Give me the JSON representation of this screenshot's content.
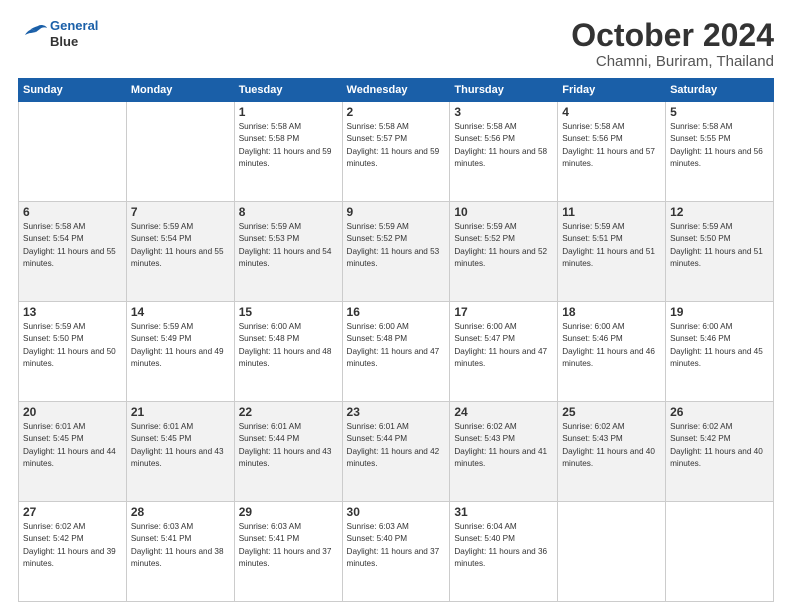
{
  "header": {
    "logo_line1": "General",
    "logo_line2": "Blue",
    "month": "October 2024",
    "location": "Chamni, Buriram, Thailand"
  },
  "weekdays": [
    "Sunday",
    "Monday",
    "Tuesday",
    "Wednesday",
    "Thursday",
    "Friday",
    "Saturday"
  ],
  "weeks": [
    [
      {
        "day": "",
        "info": ""
      },
      {
        "day": "",
        "info": ""
      },
      {
        "day": "1",
        "info": "Sunrise: 5:58 AM\nSunset: 5:58 PM\nDaylight: 11 hours and 59 minutes."
      },
      {
        "day": "2",
        "info": "Sunrise: 5:58 AM\nSunset: 5:57 PM\nDaylight: 11 hours and 59 minutes."
      },
      {
        "day": "3",
        "info": "Sunrise: 5:58 AM\nSunset: 5:56 PM\nDaylight: 11 hours and 58 minutes."
      },
      {
        "day": "4",
        "info": "Sunrise: 5:58 AM\nSunset: 5:56 PM\nDaylight: 11 hours and 57 minutes."
      },
      {
        "day": "5",
        "info": "Sunrise: 5:58 AM\nSunset: 5:55 PM\nDaylight: 11 hours and 56 minutes."
      }
    ],
    [
      {
        "day": "6",
        "info": "Sunrise: 5:58 AM\nSunset: 5:54 PM\nDaylight: 11 hours and 55 minutes."
      },
      {
        "day": "7",
        "info": "Sunrise: 5:59 AM\nSunset: 5:54 PM\nDaylight: 11 hours and 55 minutes."
      },
      {
        "day": "8",
        "info": "Sunrise: 5:59 AM\nSunset: 5:53 PM\nDaylight: 11 hours and 54 minutes."
      },
      {
        "day": "9",
        "info": "Sunrise: 5:59 AM\nSunset: 5:52 PM\nDaylight: 11 hours and 53 minutes."
      },
      {
        "day": "10",
        "info": "Sunrise: 5:59 AM\nSunset: 5:52 PM\nDaylight: 11 hours and 52 minutes."
      },
      {
        "day": "11",
        "info": "Sunrise: 5:59 AM\nSunset: 5:51 PM\nDaylight: 11 hours and 51 minutes."
      },
      {
        "day": "12",
        "info": "Sunrise: 5:59 AM\nSunset: 5:50 PM\nDaylight: 11 hours and 51 minutes."
      }
    ],
    [
      {
        "day": "13",
        "info": "Sunrise: 5:59 AM\nSunset: 5:50 PM\nDaylight: 11 hours and 50 minutes."
      },
      {
        "day": "14",
        "info": "Sunrise: 5:59 AM\nSunset: 5:49 PM\nDaylight: 11 hours and 49 minutes."
      },
      {
        "day": "15",
        "info": "Sunrise: 6:00 AM\nSunset: 5:48 PM\nDaylight: 11 hours and 48 minutes."
      },
      {
        "day": "16",
        "info": "Sunrise: 6:00 AM\nSunset: 5:48 PM\nDaylight: 11 hours and 47 minutes."
      },
      {
        "day": "17",
        "info": "Sunrise: 6:00 AM\nSunset: 5:47 PM\nDaylight: 11 hours and 47 minutes."
      },
      {
        "day": "18",
        "info": "Sunrise: 6:00 AM\nSunset: 5:46 PM\nDaylight: 11 hours and 46 minutes."
      },
      {
        "day": "19",
        "info": "Sunrise: 6:00 AM\nSunset: 5:46 PM\nDaylight: 11 hours and 45 minutes."
      }
    ],
    [
      {
        "day": "20",
        "info": "Sunrise: 6:01 AM\nSunset: 5:45 PM\nDaylight: 11 hours and 44 minutes."
      },
      {
        "day": "21",
        "info": "Sunrise: 6:01 AM\nSunset: 5:45 PM\nDaylight: 11 hours and 43 minutes."
      },
      {
        "day": "22",
        "info": "Sunrise: 6:01 AM\nSunset: 5:44 PM\nDaylight: 11 hours and 43 minutes."
      },
      {
        "day": "23",
        "info": "Sunrise: 6:01 AM\nSunset: 5:44 PM\nDaylight: 11 hours and 42 minutes."
      },
      {
        "day": "24",
        "info": "Sunrise: 6:02 AM\nSunset: 5:43 PM\nDaylight: 11 hours and 41 minutes."
      },
      {
        "day": "25",
        "info": "Sunrise: 6:02 AM\nSunset: 5:43 PM\nDaylight: 11 hours and 40 minutes."
      },
      {
        "day": "26",
        "info": "Sunrise: 6:02 AM\nSunset: 5:42 PM\nDaylight: 11 hours and 40 minutes."
      }
    ],
    [
      {
        "day": "27",
        "info": "Sunrise: 6:02 AM\nSunset: 5:42 PM\nDaylight: 11 hours and 39 minutes."
      },
      {
        "day": "28",
        "info": "Sunrise: 6:03 AM\nSunset: 5:41 PM\nDaylight: 11 hours and 38 minutes."
      },
      {
        "day": "29",
        "info": "Sunrise: 6:03 AM\nSunset: 5:41 PM\nDaylight: 11 hours and 37 minutes."
      },
      {
        "day": "30",
        "info": "Sunrise: 6:03 AM\nSunset: 5:40 PM\nDaylight: 11 hours and 37 minutes."
      },
      {
        "day": "31",
        "info": "Sunrise: 6:04 AM\nSunset: 5:40 PM\nDaylight: 11 hours and 36 minutes."
      },
      {
        "day": "",
        "info": ""
      },
      {
        "day": "",
        "info": ""
      }
    ]
  ]
}
